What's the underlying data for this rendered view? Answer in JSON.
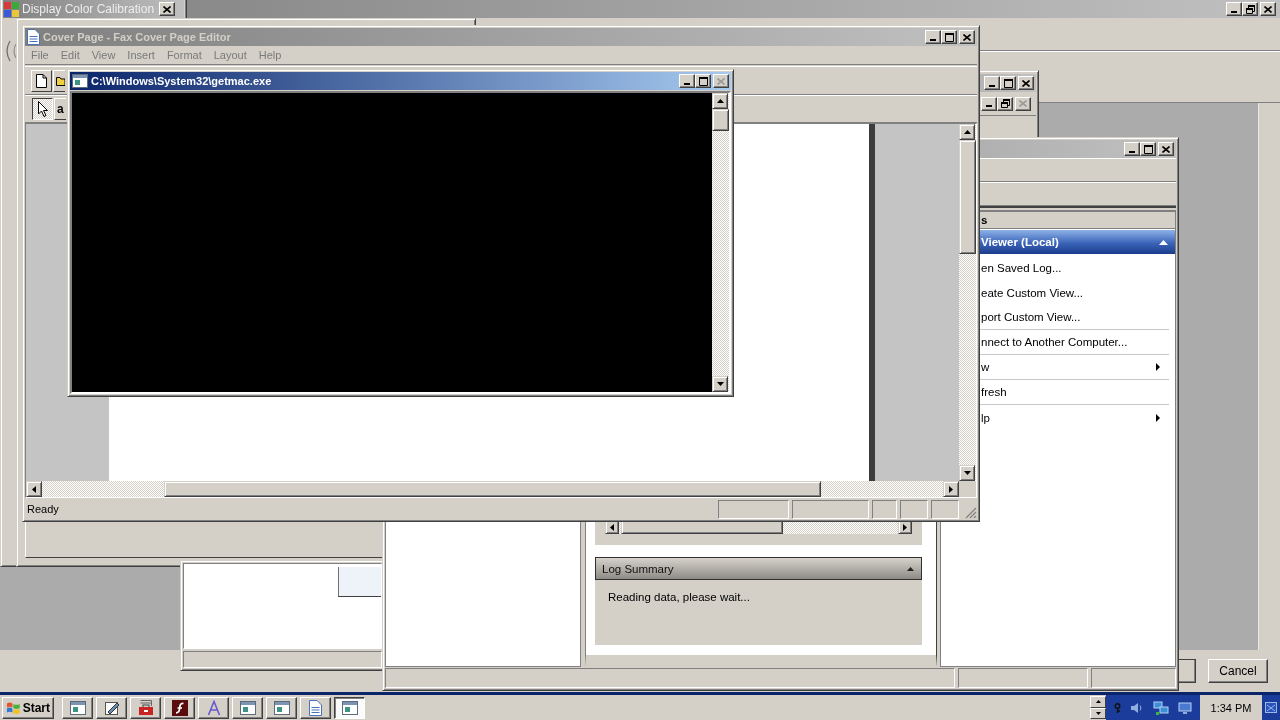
{
  "maximized_window": {
    "active": false,
    "buttons": [
      {
        "kind": "minimize",
        "disabled": false
      },
      {
        "kind": "restore",
        "disabled": false
      },
      {
        "kind": "close",
        "disabled": false
      }
    ],
    "dialog_buttons": [
      {
        "kind": "blank"
      },
      {
        "kind": "labeled",
        "label": "Cancel"
      }
    ]
  },
  "calibration_window": {
    "title": "Display Color Calibration",
    "active": false,
    "buttons": [
      {
        "kind": "close",
        "disabled": false
      }
    ]
  },
  "background_window": {
    "active": false,
    "buttons": [
      {
        "kind": "minimize",
        "disabled": false
      },
      {
        "kind": "maximize",
        "disabled": false
      },
      {
        "kind": "close",
        "disabled": false
      }
    ],
    "child_buttons": [
      {
        "kind": "minimize",
        "disabled": false
      },
      {
        "kind": "restore",
        "disabled": false
      },
      {
        "kind": "close",
        "disabled": true
      }
    ]
  },
  "event_viewer": {
    "active": false,
    "buttons": [
      {
        "kind": "minimize",
        "disabled": false
      },
      {
        "kind": "maximize",
        "disabled": false
      },
      {
        "kind": "close",
        "disabled": false
      }
    ],
    "actions_pane": {
      "heading": "s",
      "section": {
        "title": "Viewer (Local)",
        "expanded": true
      },
      "items": [
        {
          "label": "en Saved Log...",
          "submenu": false,
          "separator_after": false
        },
        {
          "label": "eate Custom View...",
          "submenu": false,
          "separator_after": false
        },
        {
          "label": "port Custom View...",
          "submenu": false,
          "separator_after": true
        },
        {
          "label": "nnect to Another Computer...",
          "submenu": false,
          "separator_after": true
        },
        {
          "label": "w",
          "submenu": true,
          "separator_after": true
        },
        {
          "label": "fresh",
          "submenu": false,
          "separator_after": true
        },
        {
          "label": "lp",
          "submenu": true,
          "separator_after": false
        }
      ]
    },
    "log_summary": {
      "title": "Log Summary",
      "expanded": true,
      "text": "Reading data, please wait..."
    }
  },
  "cover_page_editor": {
    "title": "Cover Page - Fax Cover Page Editor",
    "active": false,
    "buttons": [
      {
        "kind": "minimize",
        "disabled": false
      },
      {
        "kind": "maximize",
        "disabled": false
      },
      {
        "kind": "close",
        "disabled": false
      }
    ],
    "menu": [
      {
        "label": "File",
        "disabled": true
      },
      {
        "label": "Edit",
        "disabled": true
      },
      {
        "label": "View",
        "disabled": true
      },
      {
        "label": "Insert",
        "disabled": true
      },
      {
        "label": "Format",
        "disabled": true
      },
      {
        "label": "Layout",
        "disabled": true
      },
      {
        "label": "Help",
        "disabled": true
      }
    ],
    "toolbar": [
      {
        "kind": "new"
      },
      {
        "kind": "open"
      }
    ],
    "tools": [
      {
        "kind": "pointer",
        "selected": true
      },
      {
        "kind": "text",
        "label": "a",
        "selected": false
      }
    ],
    "status_bar": {
      "text": "Ready"
    }
  },
  "console": {
    "title": "C:\\Windows\\System32\\getmac.exe",
    "active": true,
    "buttons": [
      {
        "kind": "minimize",
        "disabled": false
      },
      {
        "kind": "maximize",
        "disabled": false
      },
      {
        "kind": "close",
        "disabled": true
      }
    ]
  },
  "taskbar": {
    "start": "Start",
    "buttons": [
      {
        "kind": "window",
        "selected": false
      },
      {
        "kind": "pen",
        "selected": false
      },
      {
        "kind": "toolbox",
        "selected": false
      },
      {
        "kind": "f_tile",
        "selected": false
      },
      {
        "kind": "font",
        "selected": false
      },
      {
        "kind": "window",
        "selected": false
      },
      {
        "kind": "window",
        "selected": false
      },
      {
        "kind": "document",
        "selected": false
      },
      {
        "kind": "window",
        "selected": true
      }
    ],
    "clock": "1:34 PM"
  }
}
